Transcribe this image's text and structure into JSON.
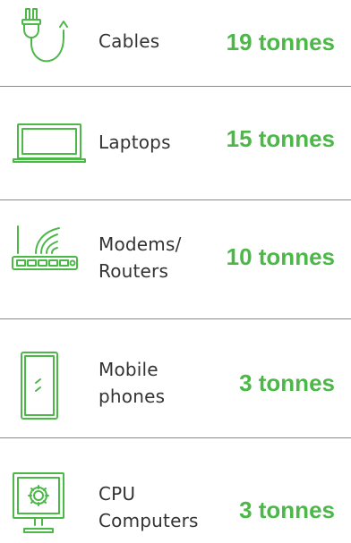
{
  "accent_color": "#4cb848",
  "items": [
    {
      "label_lines": [
        "Cables"
      ],
      "amount": "19 tonnes",
      "icon": "power-plug-icon"
    },
    {
      "label_lines": [
        "Laptops"
      ],
      "amount": "15 tonnes",
      "icon": "laptop-icon"
    },
    {
      "label_lines": [
        "Modems/",
        "Routers"
      ],
      "amount": "10 tonnes",
      "icon": "router-icon"
    },
    {
      "label_lines": [
        "Mobile",
        "phones"
      ],
      "amount": "3 tonnes",
      "icon": "mobile-phone-icon"
    },
    {
      "label_lines": [
        "CPU",
        "Computers"
      ],
      "amount": "3 tonnes",
      "icon": "computer-monitor-icon"
    }
  ]
}
